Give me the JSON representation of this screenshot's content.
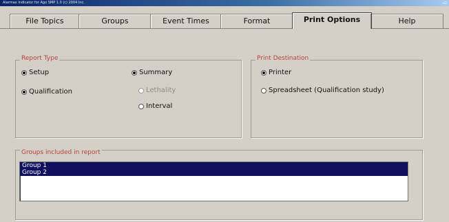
{
  "window": {
    "title": "Alarmax Indicator for Ago SMP 1.0 (c) 2004 Inc."
  },
  "tabs": [
    {
      "label": "File Topics"
    },
    {
      "label": "Groups"
    },
    {
      "label": "Event Times"
    },
    {
      "label": "Format"
    },
    {
      "label": "Print Options",
      "active": true
    },
    {
      "label": "Help"
    }
  ],
  "report_type": {
    "legend": "Report Type",
    "options": [
      {
        "label": "Setup",
        "selected": true
      },
      {
        "label": "Qualification",
        "selected": true
      },
      {
        "label": "Summary",
        "selected": true
      },
      {
        "label": "Lethality",
        "selected": false,
        "disabled": true
      },
      {
        "label": "Interval",
        "selected": false
      }
    ]
  },
  "print_destination": {
    "legend": "Print Destination",
    "options": [
      {
        "label": "Printer",
        "selected": true
      },
      {
        "label": "Spreadsheet (Qualification study)",
        "selected": false
      }
    ]
  },
  "groups_included": {
    "legend": "Groups included in report",
    "items": [
      {
        "label": "Group 1",
        "selected": true
      },
      {
        "label": "Group 2",
        "selected": true
      }
    ]
  },
  "colors": {
    "legend": "#b5413a",
    "selection": "#10105e",
    "titlebar": "#0a246a"
  }
}
